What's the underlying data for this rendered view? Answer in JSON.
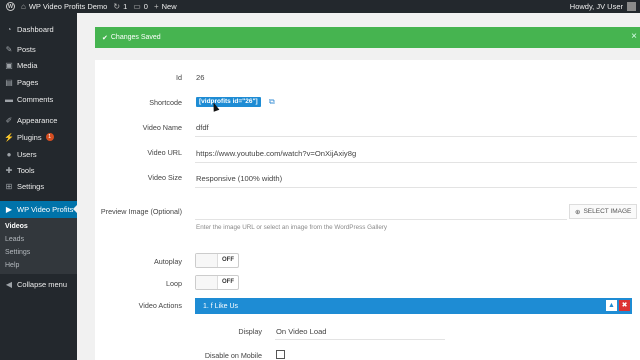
{
  "adminbar": {
    "site_name": "WP Video Profits Demo",
    "updates_count": "1",
    "comments_count": "0",
    "new_label": "New",
    "howdy": "Howdy, JV User"
  },
  "sidebar": {
    "items": [
      {
        "label": "Dashboard",
        "icon": "dashboard-icon"
      },
      {
        "label": "Posts",
        "icon": "pin-icon"
      },
      {
        "label": "Media",
        "icon": "media-icon"
      },
      {
        "label": "Pages",
        "icon": "pages-icon"
      },
      {
        "label": "Comments",
        "icon": "comments-icon"
      },
      {
        "label": "Appearance",
        "icon": "appearance-icon"
      },
      {
        "label": "Plugins",
        "icon": "plugins-icon",
        "badge": "1"
      },
      {
        "label": "Users",
        "icon": "users-icon"
      },
      {
        "label": "Tools",
        "icon": "tools-icon"
      },
      {
        "label": "Settings",
        "icon": "settings-icon"
      },
      {
        "label": "WP Video Profits",
        "icon": "video-icon"
      }
    ],
    "submenu": [
      "Videos",
      "Leads",
      "Settings",
      "Help"
    ],
    "collapse_label": "Collapse menu"
  },
  "notice": {
    "text": "Changes Saved",
    "color": "#46b450"
  },
  "form": {
    "id_label": "Id",
    "id_value": "26",
    "shortcode_label": "Shortcode",
    "shortcode_value": "[vidprofits id=\"26\"]",
    "name_label": "Video Name",
    "name_value": "dfdf",
    "url_label": "Video URL",
    "url_value": "https://www.youtube.com/watch?v=OnXijAxiy8g",
    "size_label": "Video Size",
    "size_value": "Responsive (100% width)",
    "preview_label": "Preview Image (Optional)",
    "select_image_label": "SELECT IMAGE",
    "preview_hint": "Enter the image URL or select an image from the WordPress Gallery",
    "autoplay_label": "Autoplay",
    "autoplay_state": "OFF",
    "loop_label": "Loop",
    "loop_state": "OFF",
    "actions_label": "Video Actions"
  },
  "action": {
    "title": "1. f Like Us",
    "display_label": "Display",
    "display_value": "On Video Load",
    "disable_mobile_label": "Disable on Mobile"
  },
  "colors": {
    "adminbar": "#23282d",
    "accent": "#0073aa",
    "action_header": "#1e8cd4",
    "delete": "#dc3232"
  }
}
